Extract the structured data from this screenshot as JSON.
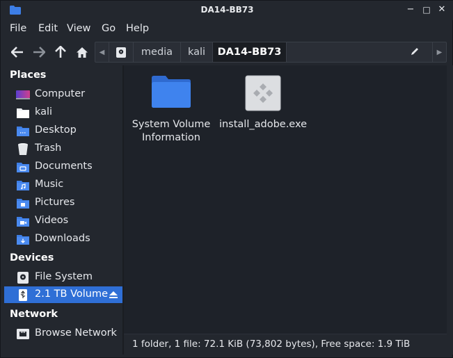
{
  "window": {
    "title": "DA14-BB73",
    "controls": [
      "−",
      "□",
      "✕"
    ]
  },
  "menu": [
    "File",
    "Edit",
    "View",
    "Go",
    "Help"
  ],
  "toolbar": {
    "breadcrumbs": [
      "media",
      "kali",
      "DA14-BB73"
    ],
    "active_crumb": "DA14-BB73"
  },
  "sidebar": {
    "places_label": "Places",
    "places": [
      {
        "label": "Computer",
        "icon": "computer-icon"
      },
      {
        "label": "kali",
        "icon": "home-folder-icon"
      },
      {
        "label": "Desktop",
        "icon": "desktop-icon"
      },
      {
        "label": "Trash",
        "icon": "trash-icon"
      },
      {
        "label": "Documents",
        "icon": "documents-folder-icon"
      },
      {
        "label": "Music",
        "icon": "music-folder-icon"
      },
      {
        "label": "Pictures",
        "icon": "pictures-folder-icon"
      },
      {
        "label": "Videos",
        "icon": "videos-folder-icon"
      },
      {
        "label": "Downloads",
        "icon": "downloads-folder-icon"
      }
    ],
    "devices_label": "Devices",
    "devices": [
      {
        "label": "File System",
        "icon": "harddisk-icon"
      },
      {
        "label": "2.1 TB Volume",
        "icon": "usb-drive-icon",
        "selected": true
      }
    ],
    "network_label": "Network",
    "network": [
      {
        "label": "Browse Network",
        "icon": "network-icon"
      }
    ]
  },
  "files": [
    {
      "name_line1": "System Volume",
      "name_line2": "Information",
      "icon": "folder-icon"
    },
    {
      "name_line1": "install_adobe.exe",
      "name_line2": "",
      "icon": "executable-icon"
    }
  ],
  "status": "1 folder, 1 file: 72.1 KiB (73,802 bytes), Free space: 1.9 TiB",
  "colors": {
    "accent": "#2f6fd6",
    "folder": "#3d7ee6",
    "background": "#1e2229"
  }
}
